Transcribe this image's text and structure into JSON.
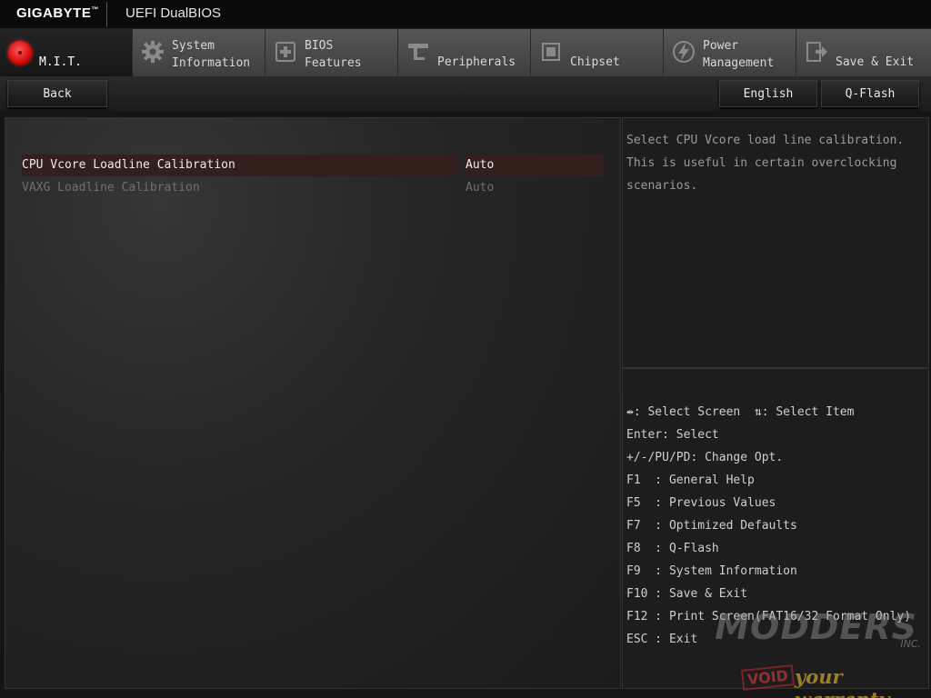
{
  "header": {
    "brand": "GIGABYTE",
    "brand_tm": "™",
    "title": "UEFI DualBIOS"
  },
  "tabs": [
    {
      "lines": [
        "M.I.T."
      ],
      "icon": "mit-dial-icon",
      "active": true
    },
    {
      "lines": [
        "System",
        "Information"
      ],
      "icon": "gear-icon",
      "active": false
    },
    {
      "lines": [
        "BIOS",
        "Features"
      ],
      "icon": "chip-plus-icon",
      "active": false
    },
    {
      "lines": [
        "Peripherals"
      ],
      "icon": "connector-icon",
      "active": false
    },
    {
      "lines": [
        "Chipset"
      ],
      "icon": "chipset-icon",
      "active": false
    },
    {
      "lines": [
        "Power",
        "Management"
      ],
      "icon": "power-bolt-icon",
      "active": false
    },
    {
      "lines": [
        "Save & Exit"
      ],
      "icon": "exit-door-icon",
      "active": false
    }
  ],
  "toolbar": {
    "back_label": "Back",
    "language_label": "English",
    "qflash_label": "Q-Flash"
  },
  "settings": [
    {
      "name": "CPU Vcore Loadline Calibration",
      "value": "Auto",
      "selected": true,
      "enabled": true
    },
    {
      "name": "VAXG Loadline Calibration",
      "value": "Auto",
      "selected": false,
      "enabled": false
    }
  ],
  "help": {
    "lines": [
      "Select CPU Vcore load line calibration.",
      "This is useful in certain overclocking",
      "scenarios."
    ]
  },
  "keys": {
    "lines": [
      "⇹: Select Screen  ⇅: Select Item",
      "Enter: Select",
      "+/-/PU/PD: Change Opt.",
      "F1  : General Help",
      "F5  : Previous Values",
      "F7  : Optimized Defaults",
      "F8  : Q-Flash",
      "F9  : System Information",
      "F10 : Save & Exit",
      "F12 : Print Screen(FAT16/32 Format Only)",
      "ESC : Exit"
    ]
  },
  "watermark": {
    "name": "MODDERS",
    "inc": "INC.",
    "void": "VOID",
    "tagline": "your warranty"
  }
}
